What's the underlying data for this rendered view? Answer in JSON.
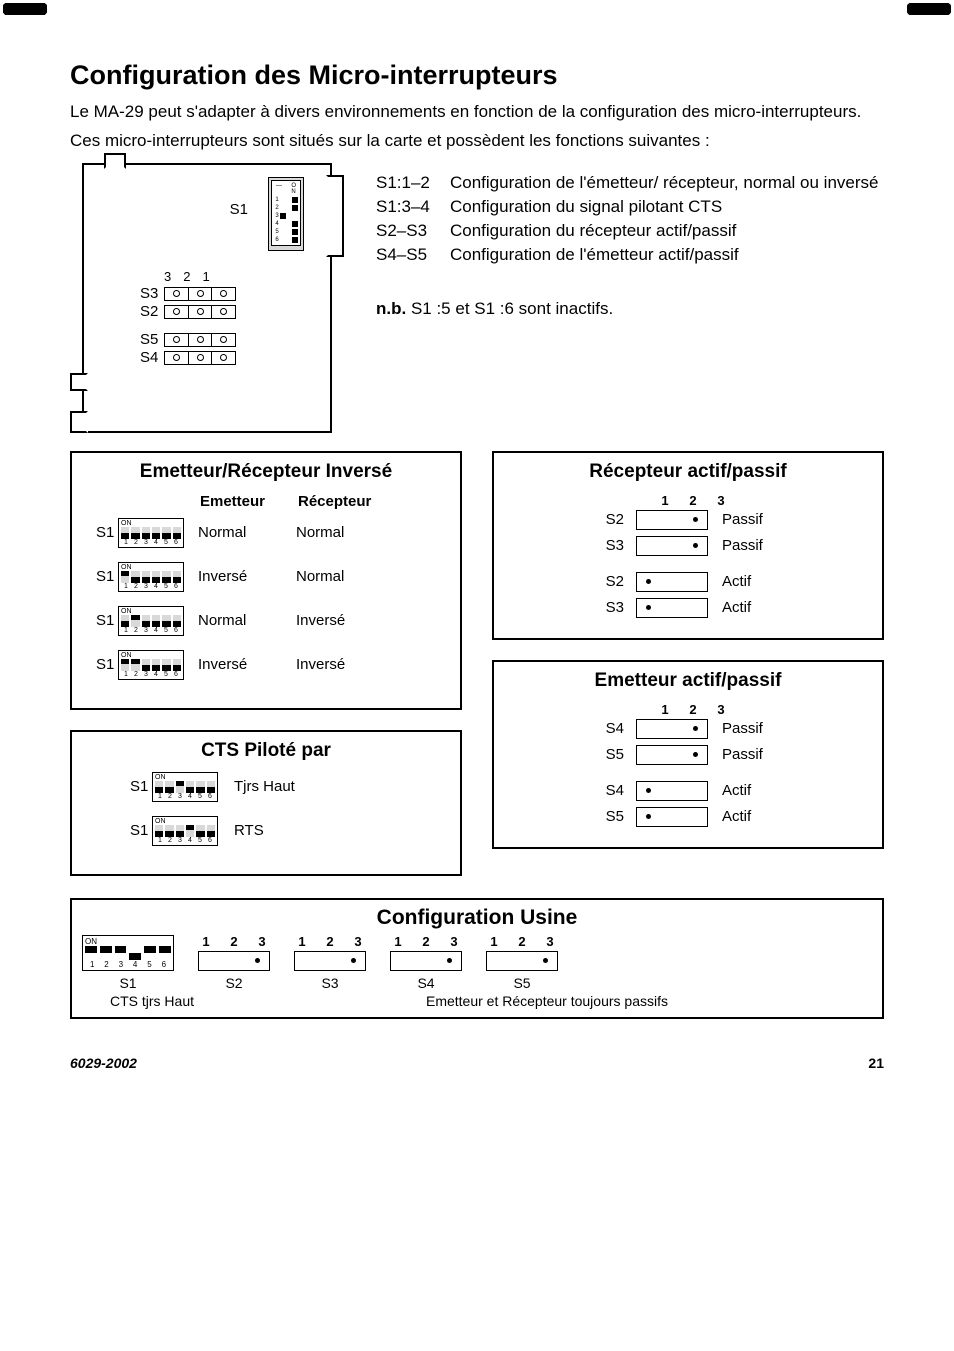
{
  "title": "Configuration des Micro-interrupteurs",
  "intro_lines": [
    "Le MA-29 peut s'adapter à divers environnements en fonction de la configuration des micro-interrupteurs.",
    "Ces micro-interrupteurs sont situés sur la carte et possèdent les fonctions suivantes :"
  ],
  "pcb": {
    "s1_label": "S1",
    "header_nums": [
      "3",
      "2",
      "1"
    ],
    "jumpers": [
      "S3",
      "S2",
      "S5",
      "S4"
    ]
  },
  "switch_map": [
    {
      "key": "S1:1–2",
      "desc": "Configuration de l'émetteur/ récepteur, normal ou inversé"
    },
    {
      "key": "S1:3–4",
      "desc": "Configuration du signal pilotant CTS"
    },
    {
      "key": "S2–S3",
      "desc": "Configuration du récepteur actif/passif"
    },
    {
      "key": "S4–S5",
      "desc": "Configuration de l'émetteur actif/passif"
    }
  ],
  "note_prefix": "n.b.",
  "note_text": " S1 :5 et S1 :6 sont inactifs.",
  "box_emetteur_recepteur": {
    "title": "Emetteur/Récepteur Inversé",
    "headers": [
      "Emetteur",
      "Récepteur"
    ],
    "label": "S1",
    "rows": [
      {
        "pattern": [
          "down",
          "down",
          "down",
          "down",
          "down",
          "down"
        ],
        "emetteur": "Normal",
        "recepteur": "Normal"
      },
      {
        "pattern": [
          "up",
          "down",
          "down",
          "down",
          "down",
          "down"
        ],
        "emetteur": "Inversé",
        "recepteur": "Normal"
      },
      {
        "pattern": [
          "down",
          "up",
          "down",
          "down",
          "down",
          "down"
        ],
        "emetteur": "Normal",
        "recepteur": "Inversé"
      },
      {
        "pattern": [
          "up",
          "up",
          "down",
          "down",
          "down",
          "down"
        ],
        "emetteur": "Inversé",
        "recepteur": "Inversé"
      }
    ]
  },
  "box_cts": {
    "title": "CTS Piloté par",
    "label": "S1",
    "rows": [
      {
        "pattern": [
          "down",
          "down",
          "up",
          "down",
          "down",
          "down"
        ],
        "value": "Tjrs Haut"
      },
      {
        "pattern": [
          "down",
          "down",
          "down",
          "up",
          "down",
          "down"
        ],
        "value": "RTS"
      }
    ]
  },
  "box_recepteur": {
    "title": "Récepteur actif/passif",
    "pins": [
      "1",
      "2",
      "3"
    ],
    "rows": [
      {
        "label": "S2",
        "link": "left",
        "value": "Passif"
      },
      {
        "label": "S3",
        "link": "left",
        "value": "Passif"
      },
      {
        "label": "S2",
        "link": "right",
        "value": "Actif"
      },
      {
        "label": "S3",
        "link": "right",
        "value": "Actif"
      }
    ]
  },
  "box_emetteur": {
    "title": "Emetteur actif/passif",
    "pins": [
      "1",
      "2",
      "3"
    ],
    "rows": [
      {
        "label": "S4",
        "link": "left",
        "value": "Passif"
      },
      {
        "label": "S5",
        "link": "left",
        "value": "Passif"
      },
      {
        "label": "S4",
        "link": "right",
        "value": "Actif"
      },
      {
        "label": "S5",
        "link": "right",
        "value": "Actif"
      }
    ]
  },
  "factory": {
    "title": "Configuration Usine",
    "pins": [
      "1",
      "2",
      "3"
    ],
    "s1": {
      "label": "S1",
      "caption": "CTS tjrs Haut",
      "pattern": [
        "up",
        "up",
        "up",
        "down",
        "up",
        "up"
      ]
    },
    "items": [
      {
        "label": "S2",
        "link": "left"
      },
      {
        "label": "S3",
        "link": "left"
      },
      {
        "label": "S4",
        "link": "left"
      },
      {
        "label": "S5",
        "link": "left"
      }
    ],
    "footnote": "Emetteur et Récepteur toujours passifs"
  },
  "footer": {
    "left": "6029-2002",
    "right": "21"
  }
}
